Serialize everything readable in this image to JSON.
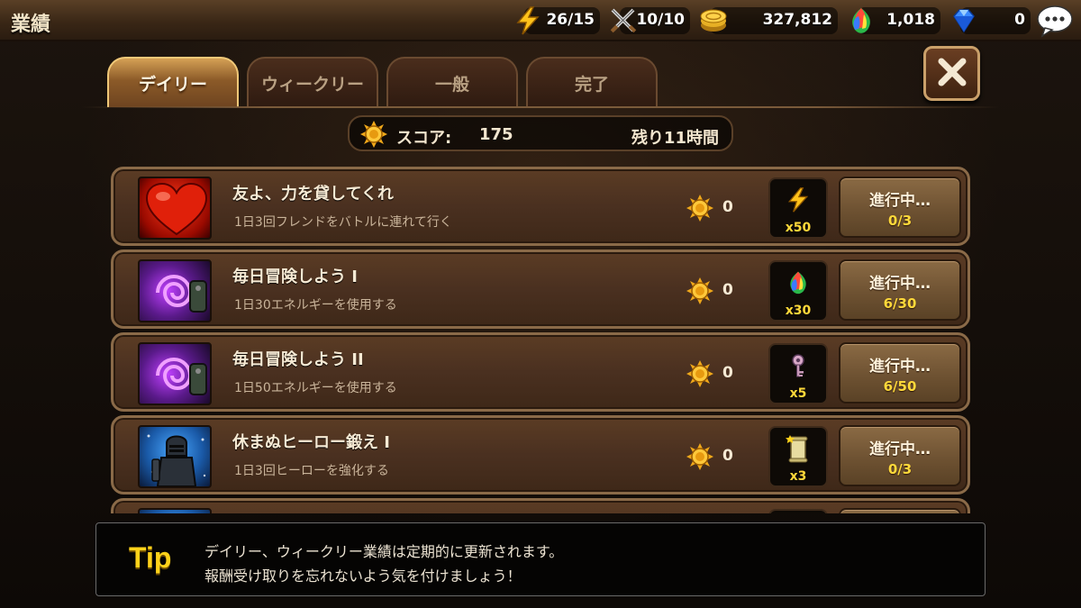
{
  "header": {
    "title": "業績",
    "resources": [
      {
        "name": "stamina",
        "icon": "lightning-icon",
        "value": "26/15"
      },
      {
        "name": "pvp-tickets",
        "icon": "crossed-swords-icon",
        "value": "10/10"
      },
      {
        "name": "gold",
        "icon": "gold-coin-icon",
        "value": "327,812"
      },
      {
        "name": "rainbow-gem",
        "icon": "rainbow-gem-icon",
        "value": "1,018"
      },
      {
        "name": "diamond",
        "icon": "blue-diamond-icon",
        "value": "0"
      }
    ],
    "chat_icon": "chat-bubble-icon"
  },
  "tabs": [
    {
      "label": "デイリー",
      "active": true
    },
    {
      "label": "ウィークリー",
      "active": false
    },
    {
      "label": "一般",
      "active": false
    },
    {
      "label": "完了",
      "active": false
    }
  ],
  "close_icon": "close-x-icon",
  "score": {
    "label": "スコア:",
    "value": "175",
    "remaining": "残り11時間"
  },
  "achievements": [
    {
      "icon": "heart-icon",
      "name": "友よ、力を貸してくれ",
      "description": "1日3回フレンドをバトルに連れて行く",
      "points": "0",
      "reward_icon": "lightning-icon",
      "reward_qty": "x50",
      "status": "進行中…",
      "progress": "0/3"
    },
    {
      "icon": "dark-portal-icon",
      "name": "毎日冒険しよう I",
      "description": "1日30エネルギーを使用する",
      "points": "0",
      "reward_icon": "rainbow-gem-icon",
      "reward_qty": "x30",
      "status": "進行中…",
      "progress": "6/30"
    },
    {
      "icon": "dark-portal-icon",
      "name": "毎日冒険しよう II",
      "description": "1日50エネルギーを使用する",
      "points": "0",
      "reward_icon": "key-icon",
      "reward_qty": "x5",
      "status": "進行中…",
      "progress": "6/50"
    },
    {
      "icon": "knight-icon",
      "name": "休まぬヒーロー鍛え I",
      "description": "1日3回ヒーローを強化する",
      "points": "0",
      "reward_icon": "scroll-icon",
      "reward_qty": "x3",
      "status": "進行中…",
      "progress": "0/3"
    }
  ],
  "tip": {
    "label": "Tip",
    "line1": "デイリー、ウィークリー業績は定期的に更新されます。",
    "line2": "報酬受け取りを忘れないよう気を付けましょう！"
  },
  "colors": {
    "accent_gold": "#ffd21a",
    "progress_yellow": "#ffd93a",
    "panel_brown": "#4a3020"
  }
}
